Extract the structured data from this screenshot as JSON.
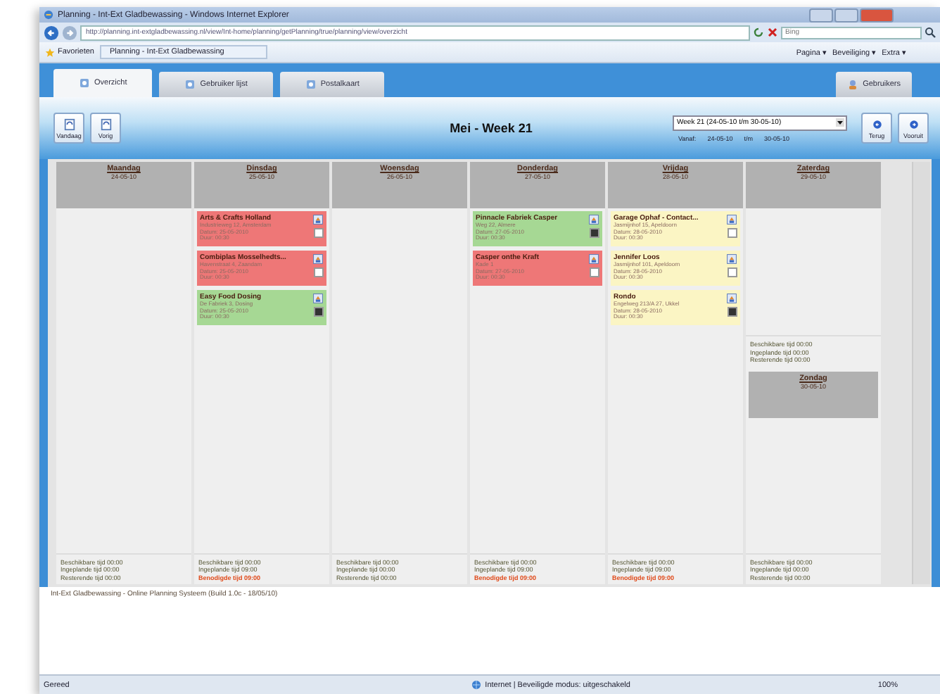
{
  "browser": {
    "title": "Planning - Int-Ext Gladbewassing - Windows Internet Explorer",
    "url": "http://planning.int-extgladbewassing.nl/view/Int-home/planning/getPlanning/true/planning/view/overzicht",
    "search_placeholder": "Bing",
    "favorites": "Favorieten",
    "page_tab": "Planning - Int-Ext Gladbewassing",
    "tools": [
      "Pagina ▾",
      "Beveiliging ▾",
      "Extra ▾"
    ]
  },
  "tabs": [
    {
      "label": "Overzicht",
      "selected": true
    },
    {
      "label": "Gebruiker lijst",
      "selected": false
    },
    {
      "label": "Postalkaart",
      "selected": false
    }
  ],
  "right_tab": "Gebruikers",
  "toolbar": {
    "left_buttons": [
      "Vandaag",
      "Vorig"
    ],
    "title": "Mei - Week 21",
    "week_select": "Week 21 (24-05-10 t/m 30-05-10)",
    "range": [
      "Vanaf:",
      "24-05-10",
      "t/m",
      "30-05-10"
    ],
    "right_buttons": [
      "Terug",
      "Vooruit"
    ]
  },
  "days": [
    {
      "name": "Maandag",
      "date": "24-05-10",
      "summary": [
        {
          "text": "Beschikbare tijd 00:00",
          "kind": "normal"
        },
        {
          "text": "Ingeplande tijd 00:00",
          "kind": "normal"
        },
        {
          "text": "Resterende tijd 00:00",
          "kind": "normal"
        }
      ]
    },
    {
      "name": "Dinsdag",
      "date": "25-05-10",
      "cards": [
        {
          "title": "Arts & Crafts Holland",
          "lines": [
            "Industrieweg 12, Amsterdam",
            "Datum: 25-05-2010",
            "Duur: 00:30"
          ],
          "color": "#ee7777",
          "checked": false
        },
        {
          "title": "Combiplas Mosselhedts...",
          "lines": [
            "Havenstraat 4, Zaandam",
            "Datum: 25-05-2010",
            "Duur: 00:30"
          ],
          "color": "#ee7777",
          "checked": false
        },
        {
          "title": "Easy Food Dosing",
          "lines": [
            "De Fabriek 3, Dosing",
            "Datum: 25-05-2010",
            "Duur: 00:30"
          ],
          "color": "#a6d894",
          "checked": true
        }
      ],
      "summary": [
        {
          "text": "Beschikbare tijd 00:00",
          "kind": "normal"
        },
        {
          "text": "Ingeplande tijd 09:00",
          "kind": "normal"
        },
        {
          "text": "Benodigde tijd 09:00",
          "kind": "required"
        }
      ]
    },
    {
      "name": "Woensdag",
      "date": "26-05-10",
      "summary": [
        {
          "text": "Beschikbare tijd 00:00",
          "kind": "normal"
        },
        {
          "text": "Ingeplande tijd 00:00",
          "kind": "normal"
        },
        {
          "text": "Resterende tijd 00:00",
          "kind": "normal"
        }
      ]
    },
    {
      "name": "Donderdag",
      "date": "27-05-10",
      "cards": [
        {
          "title": "Pinnacle Fabriek Casper",
          "lines": [
            "Weg 22, Almere",
            "Datum: 27-05-2010",
            "Duur: 00:30"
          ],
          "color": "#a6d894",
          "checked": true
        },
        {
          "title": "Casper onthe Kraft",
          "lines": [
            "Kade 1",
            "Datum: 27-05-2010",
            "Duur: 00:30"
          ],
          "color": "#ee7777",
          "checked": false
        }
      ],
      "summary": [
        {
          "text": "Beschikbare tijd 00:00",
          "kind": "normal"
        },
        {
          "text": "Ingeplande tijd 09:00",
          "kind": "normal"
        },
        {
          "text": "Benodigde tijd 09:00",
          "kind": "required"
        }
      ]
    },
    {
      "name": "Vrijdag",
      "date": "28-05-10",
      "cards": [
        {
          "title": "Garage Ophaf - Contact...",
          "lines": [
            "Jasmijnhof 15, Apeldoorn",
            "Datum: 28-05-2010",
            "Duur: 00:30"
          ],
          "color": "#fbf5c4",
          "checked": false
        },
        {
          "title": "Jennifer Loos",
          "lines": [
            "Jasmijnhof 101, Apeldoorn",
            "Datum: 28-05-2010",
            "Duur: 00:30"
          ],
          "color": "#fbf5c4",
          "checked": false
        },
        {
          "title": "Rondo",
          "lines": [
            "Engelweg 213/A 27, Ukkel",
            "Datum: 28-05-2010",
            "Duur: 00:30"
          ],
          "color": "#fbf5c4",
          "checked": true
        }
      ],
      "summary": [
        {
          "text": "Beschikbare tijd 00:00",
          "kind": "normal"
        },
        {
          "text": "Ingeplande tijd 09:00",
          "kind": "normal"
        },
        {
          "text": "Benodigde tijd 09:00",
          "kind": "required"
        }
      ]
    },
    {
      "name": "Zaterdag",
      "date": "29-05-10",
      "summary": [
        {
          "text": "Beschikbare tijd 00:00",
          "kind": "normal"
        },
        {
          "text": "Ingeplande tijd 00:00",
          "kind": "normal"
        },
        {
          "text": "Resterende tijd 00:00",
          "kind": "normal"
        }
      ],
      "sub_day": {
        "name": "Zondag",
        "date": "30-05-10",
        "summary": [
          {
            "text": "Beschikbare tijd 00:00",
            "kind": "normal"
          },
          {
            "text": "Ingeplande tijd 00:00",
            "kind": "normal"
          },
          {
            "text": "Resterende tijd 00:00",
            "kind": "normal"
          }
        ]
      }
    }
  ],
  "footer": "Int-Ext Gladbewassing - Online Planning Systeem (Build 1.0c - 18/05/10)",
  "status_bar": {
    "left": "Gereed",
    "zone": "Internet | Beveiligde modus: uitgeschakeld",
    "zoom": "100%"
  }
}
